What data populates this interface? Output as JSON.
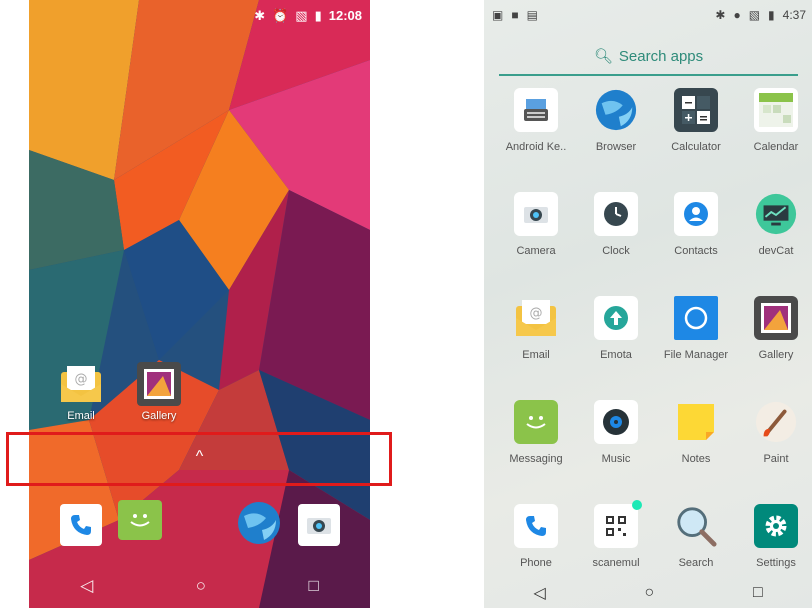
{
  "left_phone": {
    "status": {
      "time": "12:08",
      "icons": [
        "bluetooth-icon",
        "alarm-icon",
        "no-sim-icon",
        "battery-icon"
      ]
    },
    "home_icons": [
      {
        "label": "Email",
        "icon": "email-icon"
      },
      {
        "label": "Gallery",
        "icon": "gallery-icon"
      }
    ],
    "drawer_handle": "^",
    "dock": [
      "phone-icon",
      "messaging-icon",
      "browser-icon",
      "camera-icon"
    ],
    "nav": {
      "back": "◁",
      "home": "○",
      "recents": "□"
    },
    "highlight_color": "#e01b1b"
  },
  "right_phone": {
    "status": {
      "time": "4:37",
      "left_icons": [
        "image-notification-icon",
        "stop-icon",
        "sd-card-icon"
      ],
      "right_icons": [
        "bluetooth-icon",
        "dnd-icon",
        "no-sim-icon",
        "battery-icon"
      ]
    },
    "search": {
      "placeholder": "Search apps",
      "accent": "#2e8b7a"
    },
    "apps": [
      {
        "label": "Android Ke..",
        "icon": "keyboard-icon"
      },
      {
        "label": "Browser",
        "icon": "browser-icon"
      },
      {
        "label": "Calculator",
        "icon": "calculator-icon"
      },
      {
        "label": "Calendar",
        "icon": "calendar-icon"
      },
      {
        "label": "Camera",
        "icon": "camera-icon"
      },
      {
        "label": "Clock",
        "icon": "clock-icon"
      },
      {
        "label": "Contacts",
        "icon": "contacts-icon"
      },
      {
        "label": "devCat",
        "icon": "devcat-icon"
      },
      {
        "label": "Email",
        "icon": "email-icon"
      },
      {
        "label": "Emota",
        "icon": "emota-icon"
      },
      {
        "label": "File Manager",
        "icon": "file-manager-icon"
      },
      {
        "label": "Gallery",
        "icon": "gallery-icon"
      },
      {
        "label": "Messaging",
        "icon": "messaging-icon"
      },
      {
        "label": "Music",
        "icon": "music-icon"
      },
      {
        "label": "Notes",
        "icon": "notes-icon"
      },
      {
        "label": "Paint",
        "icon": "paint-icon"
      },
      {
        "label": "Phone",
        "icon": "phone-icon"
      },
      {
        "label": "scanemul",
        "icon": "qr-code-icon"
      },
      {
        "label": "Search",
        "icon": "search-icon"
      },
      {
        "label": "Settings",
        "icon": "gear-icon"
      }
    ],
    "nav": {
      "back": "◁",
      "home": "○",
      "recents": "□"
    }
  }
}
